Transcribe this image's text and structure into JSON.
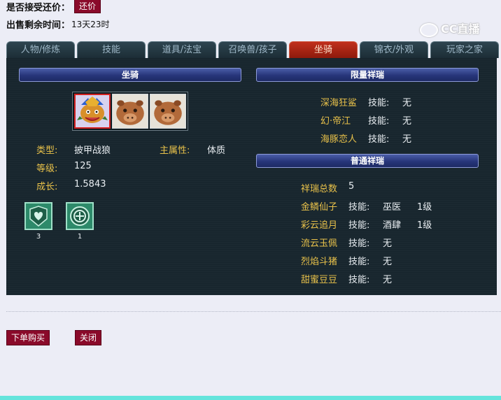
{
  "header": {
    "accept_label": "是否接受还价：",
    "counter_offer_button": "还价",
    "time_label": "出售剩余时间：",
    "time_value": "13天23时",
    "logo_text": "CC直播"
  },
  "tabs": [
    {
      "label": "人物/修炼",
      "active": false
    },
    {
      "label": "技能",
      "active": false
    },
    {
      "label": "道具/法宝",
      "active": false
    },
    {
      "label": "召唤兽/孩子",
      "active": false
    },
    {
      "label": "坐骑",
      "active": true
    },
    {
      "label": "锦衣/外观",
      "active": false
    },
    {
      "label": "玩家之家",
      "active": false
    }
  ],
  "mount": {
    "section_title": "坐骑",
    "type_label": "类型:",
    "type_value": "披甲战狼",
    "attr_label": "主属性:",
    "attr_value": "体质",
    "level_label": "等级:",
    "level_value": "125",
    "growth_label": "成长:",
    "growth_value": "1.5843",
    "stat_icons": [
      {
        "icon": "heart-shield-icon",
        "count": "3"
      },
      {
        "icon": "coin-emblem-icon",
        "count": "1"
      }
    ]
  },
  "limited": {
    "section_title": "限量祥瑞",
    "items": [
      {
        "name": "深海狂鲨",
        "skill_label": "技能:",
        "skill": "无"
      },
      {
        "name": "幻·帝江",
        "skill_label": "技能:",
        "skill": "无"
      },
      {
        "name": "海豚恋人",
        "skill_label": "技能:",
        "skill": "无"
      }
    ]
  },
  "normal": {
    "section_title": "普通祥瑞",
    "total_label": "祥瑞总数",
    "total_value": "5",
    "items": [
      {
        "name": "金鳞仙子",
        "skill_label": "技能:",
        "skill": "巫医",
        "level": "1级"
      },
      {
        "name": "彩云追月",
        "skill_label": "技能:",
        "skill": "酒肆",
        "level": "1级"
      },
      {
        "name": "流云玉佩",
        "skill_label": "技能:",
        "skill": "无",
        "level": ""
      },
      {
        "name": "烈焰斗猪",
        "skill_label": "技能:",
        "skill": "无",
        "level": ""
      },
      {
        "name": "甜蜜豆豆",
        "skill_label": "技能:",
        "skill": "无",
        "level": ""
      }
    ]
  },
  "actions": {
    "buy_button": "下单购买",
    "close_button": "关闭"
  },
  "colors": {
    "accent_maroon": "#8a0a2a",
    "active_tab": "#b82a18",
    "panel_bg": "#18262e",
    "gold_text": "#e8c14a"
  }
}
